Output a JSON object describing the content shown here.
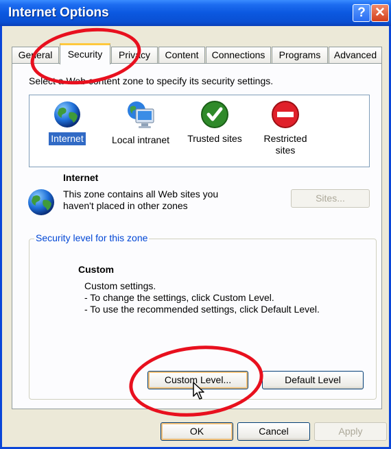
{
  "window": {
    "title": "Internet Options"
  },
  "title_buttons": {
    "help": "?",
    "close": "✕"
  },
  "tabs": [
    {
      "label": "General"
    },
    {
      "label": "Security"
    },
    {
      "label": "Privacy"
    },
    {
      "label": "Content"
    },
    {
      "label": "Connections"
    },
    {
      "label": "Programs"
    },
    {
      "label": "Advanced"
    }
  ],
  "security": {
    "instruction": "Select a Web content zone to specify its security settings.",
    "zones": [
      {
        "label": "Internet",
        "icon": "globe-icon",
        "selected": true
      },
      {
        "label": "Local intranet",
        "icon": "monitor-globe-icon",
        "selected": false
      },
      {
        "label": "Trusted sites",
        "icon": "checkmark-icon",
        "selected": false
      },
      {
        "label": "Restricted\nsites",
        "icon": "restricted-icon",
        "selected": false
      }
    ],
    "zone_info": {
      "name": "Internet",
      "line1": "This zone contains all Web sites you",
      "line2": "haven't placed in other zones"
    },
    "sites_button": "Sites...",
    "group_label": "Security level for this zone",
    "level": {
      "name": "Custom",
      "line1": "Custom settings.",
      "line2": "- To change the settings, click Custom Level.",
      "line3": "- To use the recommended settings, click Default Level."
    },
    "custom_level_button": "Custom Level...",
    "default_level_button": "Default Level"
  },
  "footer": {
    "ok": "OK",
    "cancel": "Cancel",
    "apply": "Apply"
  },
  "colors": {
    "titlebar": "#0a58e0",
    "selection": "#316ac5",
    "annotation": "#e8101e"
  }
}
